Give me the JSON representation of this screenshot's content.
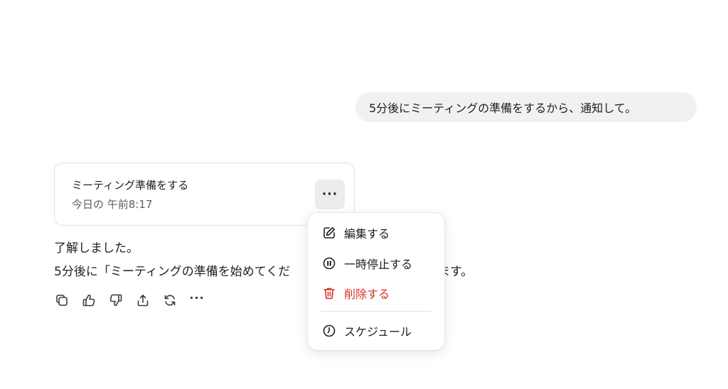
{
  "user_message": "5分後にミーティングの準備をするから、通知して。",
  "task_card": {
    "title": "ミーティング準備をする",
    "time": "今日の 午前8:17",
    "more_label": "···"
  },
  "reply": {
    "line1": "了解しました。",
    "line2": "5分後に「ミーティングの準備を始めてくだ",
    "line2_tail": "ます。"
  },
  "action_bar": {
    "icons": [
      "copy-icon",
      "thumbs-up-icon",
      "thumbs-down-icon",
      "share-icon",
      "regenerate-icon",
      "more-icon"
    ],
    "more_label": "···"
  },
  "menu": {
    "items": [
      {
        "label": "編集する",
        "icon": "edit-icon"
      },
      {
        "label": "一時停止する",
        "icon": "pause-icon"
      },
      {
        "label": "削除する",
        "icon": "trash-icon",
        "color": "#d93025"
      },
      {
        "label": "スケジュール",
        "icon": "clock-icon"
      }
    ]
  }
}
